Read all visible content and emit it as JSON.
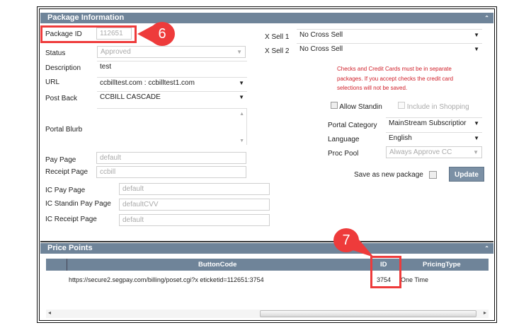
{
  "package_info": {
    "title": "Package Information",
    "collapse_icon": "double-chevron-up-icon",
    "package_id": {
      "label": "Package ID",
      "value": "112651"
    },
    "status": {
      "label": "Status",
      "value": "Approved"
    },
    "description": {
      "label": "Description",
      "value": "test"
    },
    "url": {
      "label": "URL",
      "value": "ccbilltest.com : ccbilltest1.com"
    },
    "post_back": {
      "label": "Post Back",
      "value": "CCBILL CASCADE"
    },
    "portal_blurb": {
      "label": "Portal Blurb",
      "value": ""
    },
    "pay_page": {
      "label": "Pay Page",
      "value": "default"
    },
    "receipt_page": {
      "label": "Receipt Page",
      "value": "ccbill"
    },
    "ic_pay_page": {
      "label": "IC Pay Page",
      "value": "default"
    },
    "ic_standin_pay_page": {
      "label": "IC Standin Pay Page",
      "value": "defaultCVV"
    },
    "ic_receipt_page": {
      "label": "IC Receipt Page",
      "value": "default"
    },
    "xsell1": {
      "label": "X Sell 1",
      "value": "No Cross Sell"
    },
    "xsell2": {
      "label": "X Sell 2",
      "value": "No Cross Sell"
    },
    "warning": "Checks and Credit Cards must be in separate packages. If you accept checks the credit card selections will not be saved.",
    "allow_standin": "Allow Standin",
    "include_in_shopping": "Include in Shopping",
    "portal_category": {
      "label": "Portal Category",
      "value": "MainStream Subscriptior"
    },
    "language": {
      "label": "Language",
      "value": "English"
    },
    "proc_pool": {
      "label": "Proc Pool",
      "value": "Always Approve CC"
    },
    "save_as_new": "Save as new package",
    "update_button": "Update"
  },
  "price_points": {
    "title": "Price Points",
    "columns": [
      "ButtonCode",
      "ID",
      "PricingType"
    ],
    "rows": [
      {
        "button_code": "https://secure2.segpay.com/billing/poset.cgi?x eticketid=112651:3754",
        "id": "3754",
        "pricing_type": "One Time"
      }
    ]
  },
  "callouts": [
    "6",
    "7"
  ],
  "colors": {
    "header": "#6f8499",
    "callout": "#ee3b3b",
    "warning": "#d0202a"
  }
}
